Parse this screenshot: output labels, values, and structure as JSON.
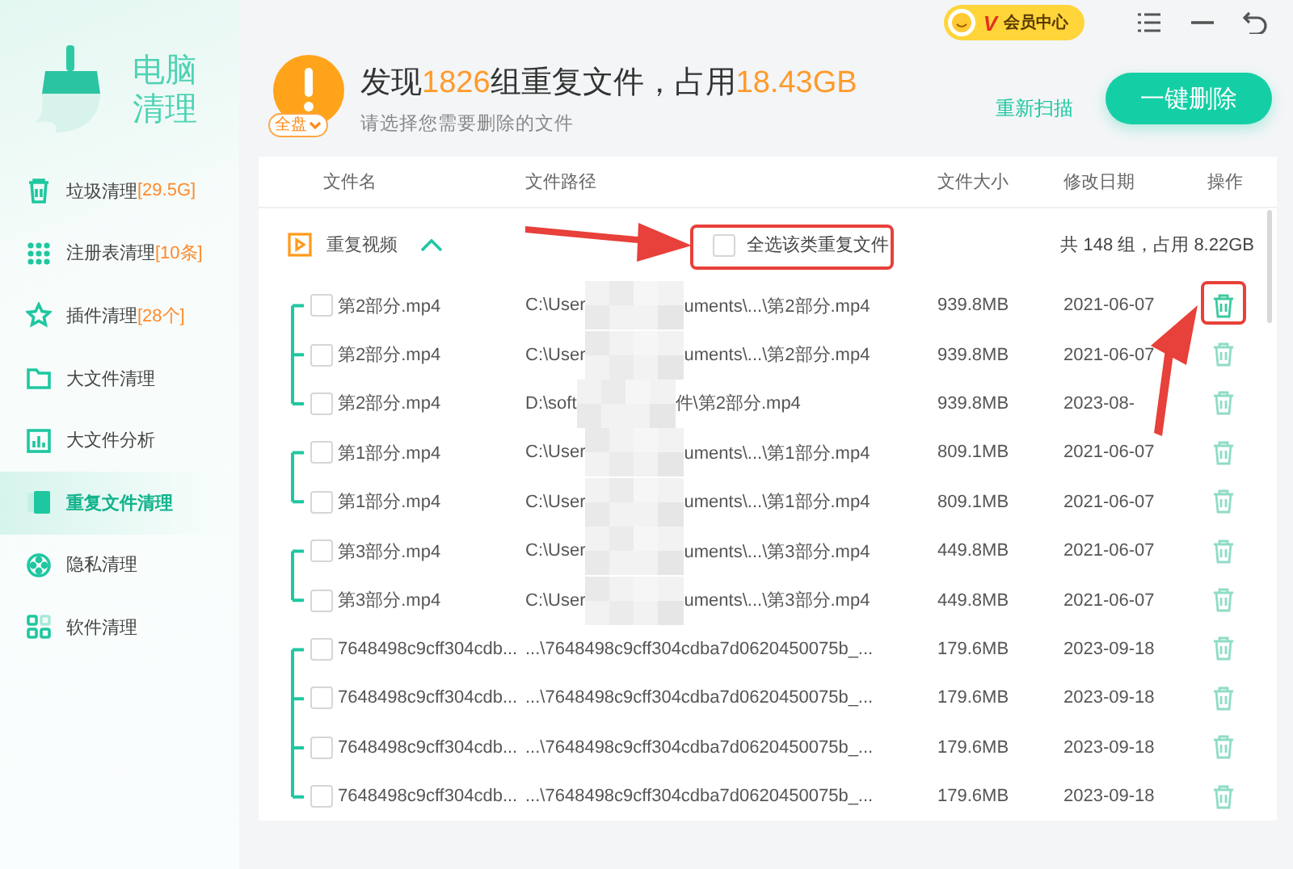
{
  "app": {
    "title_line1": "电脑",
    "title_line2": "清理"
  },
  "topbar": {
    "vip_badge": "V",
    "vip_label": "会员中心"
  },
  "sidebar": {
    "items": [
      {
        "label": "垃圾清理",
        "count": "[29.5G]",
        "selected": false
      },
      {
        "label": "注册表清理",
        "count": "[10条]",
        "selected": false
      },
      {
        "label": "插件清理",
        "count": "[28个]",
        "selected": false
      },
      {
        "label": "大文件清理",
        "selected": false
      },
      {
        "label": "大文件分析",
        "selected": false
      },
      {
        "label": "重复文件清理",
        "selected": true
      },
      {
        "label": "隐私清理",
        "selected": false
      },
      {
        "label": "软件清理",
        "selected": false
      }
    ]
  },
  "summary": {
    "title": [
      {
        "text": "发现",
        "highlight": false
      },
      {
        "text": "1826",
        "highlight": true
      },
      {
        "text": "组重复文件，占用",
        "highlight": false
      },
      {
        "text": "18.43GB",
        "highlight": true
      }
    ],
    "subtitle": "请选择您需要删除的文件",
    "scope": "全盘",
    "rescan": "重新扫描",
    "delete_all": "一键删除"
  },
  "table": {
    "columns": [
      "文件名",
      "文件路径",
      "文件大小",
      "修改日期",
      "操作"
    ],
    "category": {
      "name": "重复视频",
      "expanded": true,
      "select_all": {
        "label": "全选该类重复文件",
        "checked": false
      },
      "total": "共 148 组，占用 8.22GB"
    },
    "groups": [
      {
        "rows": [
          {
            "name": "第2部分.mp4",
            "path_start": "C:\\User",
            "redacted": true,
            "path_end": "uments\\...\\第2部分.mp4",
            "size": "939.8MB",
            "date": "2021-06-07",
            "checked": false
          },
          {
            "name": "第2部分.mp4",
            "path_start": "C:\\User",
            "redacted": true,
            "path_end": "uments\\...\\第2部分.mp4",
            "size": "939.8MB",
            "date": "2021-06-07",
            "checked": false
          },
          {
            "name": "第2部分.mp4",
            "path_start": "D:\\soft",
            "redacted": true,
            "path_end": "件\\第2部分.mp4",
            "size": "939.8MB",
            "date": "2023-08-",
            "checked": false
          }
        ]
      },
      {
        "rows": [
          {
            "name": "第1部分.mp4",
            "path_start": "C:\\User",
            "redacted": true,
            "path_end": "uments\\...\\第1部分.mp4",
            "size": "809.1MB",
            "date": "2021-06-07",
            "checked": false
          },
          {
            "name": "第1部分.mp4",
            "path_start": "C:\\User",
            "redacted": true,
            "path_end": "uments\\...\\第1部分.mp4",
            "size": "809.1MB",
            "date": "2021-06-07",
            "checked": false
          }
        ]
      },
      {
        "rows": [
          {
            "name": "第3部分.mp4",
            "path_start": "C:\\User",
            "redacted": true,
            "path_end": "uments\\...\\第3部分.mp4",
            "size": "449.8MB",
            "date": "2021-06-07",
            "checked": false
          },
          {
            "name": "第3部分.mp4",
            "path_start": "C:\\User",
            "redacted": true,
            "path_end": "uments\\...\\第3部分.mp4",
            "size": "449.8MB",
            "date": "2021-06-07",
            "checked": false
          }
        ]
      },
      {
        "rows": [
          {
            "name": "7648498c9cff304cdb...",
            "path_start": "...\\7648498c9cff304cdba7d0620450075b_...",
            "redacted": false,
            "size": "179.6MB",
            "date": "2023-09-18",
            "checked": false
          },
          {
            "name": "7648498c9cff304cdb...",
            "path_start": "...\\7648498c9cff304cdba7d0620450075b_...",
            "redacted": false,
            "size": "179.6MB",
            "date": "2023-09-18",
            "checked": false
          },
          {
            "name": "7648498c9cff304cdb...",
            "path_start": "...\\7648498c9cff304cdba7d0620450075b_...",
            "redacted": false,
            "size": "179.6MB",
            "date": "2023-09-18",
            "checked": false
          },
          {
            "name": "7648498c9cff304cdb...",
            "path_start": "...\\7648498c9cff304cdba7d0620450075b_...",
            "redacted": false,
            "size": "179.6MB",
            "date": "2023-09-18",
            "checked": false
          }
        ]
      }
    ]
  }
}
